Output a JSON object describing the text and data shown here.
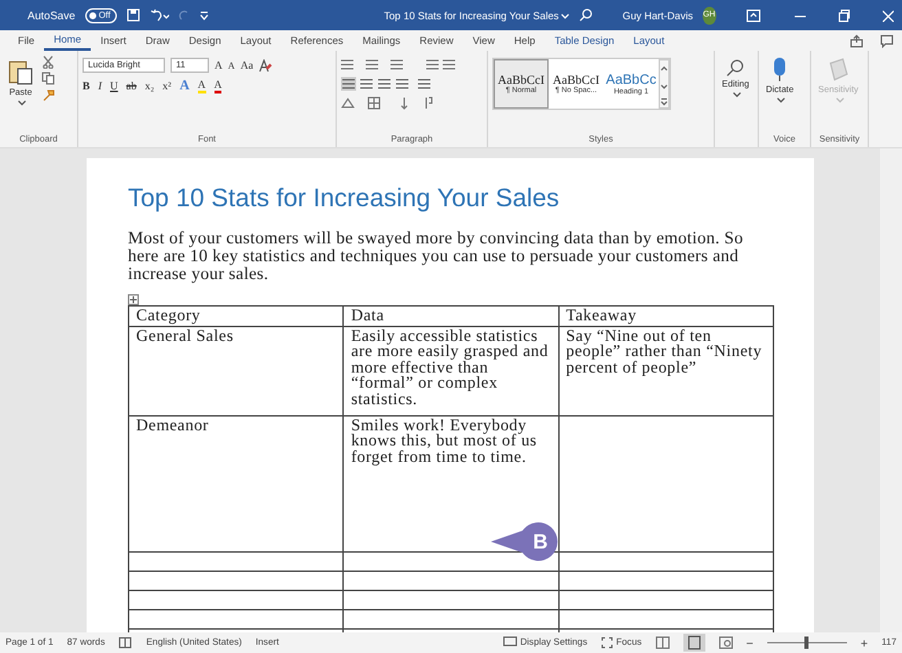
{
  "window": {
    "autosave_label": "AutoSave",
    "autosave": {
      "label": "Off",
      "on": false
    },
    "title": "Top 10 Stats for Increasing Your Sales",
    "user": "Guy Hart-Davis",
    "initials": "GH"
  },
  "tabs": [
    {
      "label": "File",
      "selected": false,
      "kind": "normal"
    },
    {
      "label": "Home",
      "selected": true,
      "kind": "normal"
    },
    {
      "label": "Insert",
      "selected": false,
      "kind": "normal"
    },
    {
      "label": "Draw",
      "selected": false,
      "kind": "normal"
    },
    {
      "label": "Design",
      "selected": false,
      "kind": "normal"
    },
    {
      "label": "Layout",
      "selected": false,
      "kind": "normal"
    },
    {
      "label": "References",
      "selected": false,
      "kind": "normal"
    },
    {
      "label": "Mailings",
      "selected": false,
      "kind": "normal"
    },
    {
      "label": "Review",
      "selected": false,
      "kind": "normal"
    },
    {
      "label": "View",
      "selected": false,
      "kind": "normal"
    },
    {
      "label": "Help",
      "selected": false,
      "kind": "normal"
    },
    {
      "label": "Table Design",
      "selected": false,
      "kind": "contextual"
    },
    {
      "label": "Layout",
      "selected": false,
      "kind": "contextual"
    }
  ],
  "ribbon": {
    "clipboard": {
      "paste": "Paste",
      "label": "Clipboard"
    },
    "font": {
      "name": "Lucida Bright",
      "size": "11",
      "grow": "A",
      "shrink": "A",
      "case": "Aa",
      "bold": "B",
      "italic": "I",
      "underline": "U",
      "strikethrough": "ab",
      "subscript": "x₂",
      "superscript": "x²",
      "effects": "A",
      "highlight": "A",
      "font_color_button": "A",
      "label": "Font"
    },
    "paragraph": {
      "label": "Paragraph"
    },
    "styles": {
      "items": [
        {
          "sample": "AaBbCcI",
          "name": "¶ Normal",
          "selected": true,
          "kind": "body"
        },
        {
          "sample": "AaBbCcI",
          "name": "¶ No Spac...",
          "selected": false,
          "kind": "body"
        },
        {
          "sample": "AaBbCc",
          "name": "Heading 1",
          "selected": false,
          "kind": "heading"
        }
      ],
      "label": "Styles"
    },
    "editing": "Editing",
    "voice": {
      "button": "Dictate",
      "label": "Voice"
    },
    "sensitivity": {
      "button": "Sensitivity",
      "label": "Sensitivity",
      "disabled": true
    }
  },
  "document": {
    "heading": "Top 10 Stats for Increasing Your Sales",
    "paragraph": "Most of your customers will be swayed more by convincing data than by emotion. So here are 10 key statistics and techniques you can use to persuade your customers and increase your sales.",
    "table": {
      "columns": [
        "Category",
        "Data",
        "Takeaway"
      ],
      "rows": [
        {
          "category": "General Sales",
          "data": "Easily accessible statistics are more easily grasped and more effective than “formal” or complex statistics.",
          "takeaway": "Say “Nine out of ten people” rather than “Ninety percent of people”"
        },
        {
          "category": "Demeanor",
          "data": "Smiles work! Everybody knows this, but most of us forget from time to time."
        },
        {},
        {},
        {},
        {},
        {}
      ]
    },
    "callout": "B"
  },
  "status_bar": {
    "page": "Page 1 of 1",
    "words": "87 words",
    "language": "English (United States)",
    "mode": "Insert",
    "display_settings": "Display Settings",
    "focus": "Focus",
    "zoom": {
      "out": "−",
      "level": 0.47,
      "in": "+",
      "percent": "117"
    }
  }
}
